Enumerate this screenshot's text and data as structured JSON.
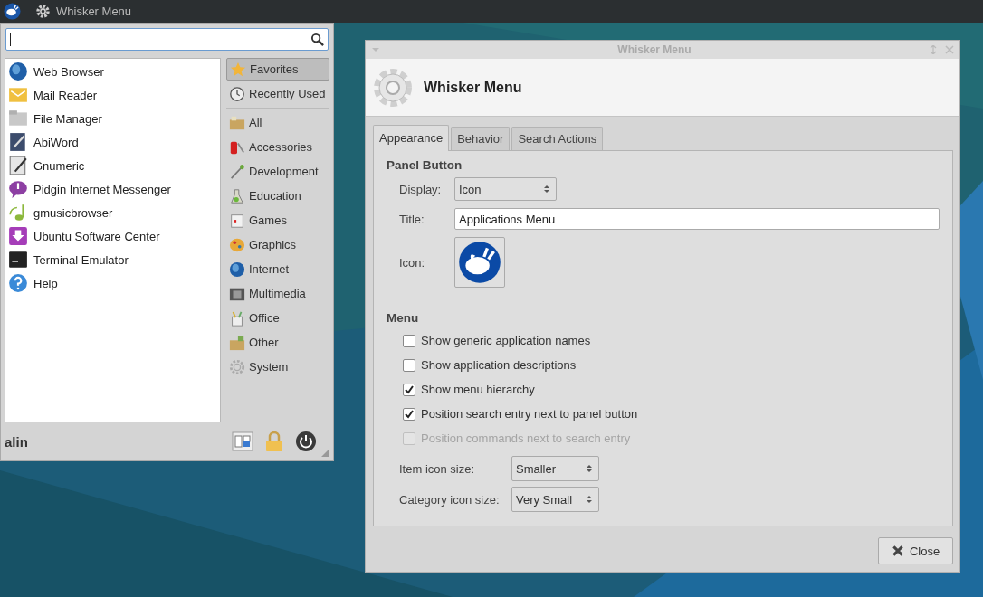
{
  "panel": {
    "title": "Whisker Menu"
  },
  "menu": {
    "apps": [
      "Web Browser",
      "Mail Reader",
      "File Manager",
      "AbiWord",
      "Gnumeric",
      "Pidgin Internet Messenger",
      "gmusicbrowser",
      "Ubuntu Software Center",
      "Terminal Emulator",
      "Help"
    ],
    "views": [
      {
        "label": "Favorites",
        "selected": true
      },
      {
        "label": "Recently Used",
        "selected": false
      }
    ],
    "categories": [
      {
        "label": "All",
        "selected": false
      },
      {
        "label": "Accessories",
        "selected": false
      },
      {
        "label": "Development",
        "selected": false
      },
      {
        "label": "Education",
        "selected": false
      },
      {
        "label": "Games",
        "selected": false
      },
      {
        "label": "Graphics",
        "selected": false
      },
      {
        "label": "Internet",
        "selected": false
      },
      {
        "label": "Multimedia",
        "selected": false
      },
      {
        "label": "Office",
        "selected": false
      },
      {
        "label": "Other",
        "selected": false
      },
      {
        "label": "System",
        "selected": false
      }
    ],
    "user": "alin"
  },
  "dialog": {
    "title": "Whisker Menu",
    "heading": "Whisker Menu",
    "tabs": [
      {
        "label": "Appearance",
        "selected": true
      },
      {
        "label": "Behavior",
        "selected": false
      },
      {
        "label": "Search Actions",
        "selected": false
      }
    ],
    "panel_button": {
      "heading": "Panel Button",
      "display_label": "Display:",
      "display_value": "Icon",
      "title_label": "Title:",
      "title_value": "Applications Menu",
      "icon_label": "Icon:"
    },
    "menu": {
      "heading": "Menu",
      "options": [
        {
          "label": "Show generic application names",
          "checked": false,
          "disabled": false
        },
        {
          "label": "Show application descriptions",
          "checked": false,
          "disabled": false
        },
        {
          "label": "Show menu hierarchy",
          "checked": true,
          "disabled": false
        },
        {
          "label": "Position search entry next to panel button",
          "checked": true,
          "disabled": false
        },
        {
          "label": "Position commands next to search entry",
          "checked": false,
          "disabled": true
        }
      ],
      "item_icon_label": "Item icon size:",
      "item_icon_value": "Smaller",
      "category_icon_label": "Category icon size:",
      "category_icon_value": "Very Small"
    },
    "close_button": "Close"
  }
}
